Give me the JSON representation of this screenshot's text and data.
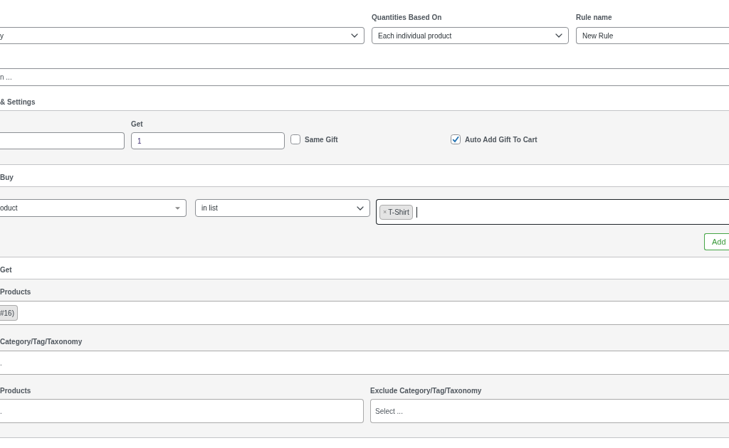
{
  "rule_fields": [
    {
      "kind": "select",
      "value": "y"
    },
    {
      "kind": "select",
      "label": "Quantities Based On",
      "value": "Each individual product"
    },
    {
      "kind": "input",
      "label": "Rule name",
      "value": "New Rule"
    }
  ],
  "description_field": {
    "placeholder": "n ..."
  },
  "settings": {
    "heading": "& Settings",
    "fields": [
      {
        "kind": "input"
      },
      {
        "kind": "input",
        "label": "Get",
        "value": "1"
      },
      {
        "kind": "checkbox",
        "label": "Same Gift",
        "checked": false
      },
      {
        "kind": "checkbox",
        "label": "Auto Add Gift To Cart",
        "checked": true
      }
    ]
  },
  "buy": {
    "heading": "Buy",
    "condition": {
      "field": "oduct",
      "operator": "in list",
      "tags": [
        {
          "remove": "×",
          "label": "T-Shirt"
        }
      ],
      "focused": true
    },
    "add_button": "Add"
  },
  "get": {
    "heading": "Get",
    "lists": [
      {
        "label": "Products",
        "tags": [
          {
            "label": "#16)"
          }
        ]
      },
      {
        "label": "Category/Tag/Taxonomy",
        "placeholder": "."
      }
    ],
    "exclude": [
      {
        "label": "Products",
        "placeholder": "."
      },
      {
        "label": "Exclude Category/Tag/Taxonomy",
        "placeholder": "Select ..."
      }
    ]
  }
}
